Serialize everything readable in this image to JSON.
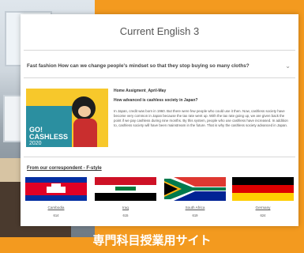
{
  "page": {
    "title": "Current English 3"
  },
  "nav": {
    "label": "Fast fashion   How can we change people's mindset so that they stop buying so many cloths?",
    "chevron": "⌄"
  },
  "banner": {
    "line1": "GO!",
    "line2": "CASHLESS",
    "year": "2020"
  },
  "article": {
    "subheading": "Home Assigment_April-May",
    "headline": "How advanced is cashless society in Japan?",
    "body": "In Japan, credit was born in 1960. But there were few people who could use it then. Now, cashless society have become very common in Japan because the tax rate went up. With the tax rate going up, we are given back the point if we pay cashless during nine months. By this system, people who use cashless have increased. In addition to, cashless society will have been mainstream in the future. That is why the cashless society advanced in Japan."
  },
  "correspondent": {
    "label": "From our correspondent - F-style"
  },
  "flags": [
    {
      "country": "Cambodia",
      "code": "614"
    },
    {
      "country": "Iraq",
      "code": "615"
    },
    {
      "country": "South Africa",
      "code": "619"
    },
    {
      "country": "Germany",
      "code": "624"
    }
  ],
  "caption": "専門科目授業用サイト"
}
